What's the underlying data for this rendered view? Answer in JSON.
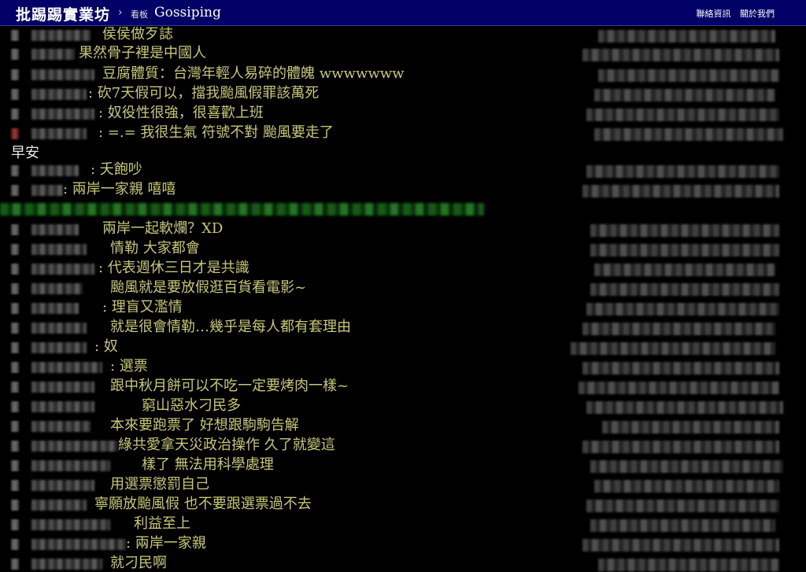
{
  "header": {
    "site_title": "批踢踢實業坊",
    "separator": "›",
    "board_label": "看板",
    "board_name": "Gossiping",
    "links": [
      "聯絡資訊",
      "關於我們"
    ]
  },
  "plain_text": "早安",
  "pushes": [
    {
      "text": "侯侯做歹誌",
      "tag": "gray"
    },
    {
      "text": "果然骨子裡是中國人",
      "tag": "gray"
    },
    {
      "text": "豆腐體質：台灣年輕人易碎的體魄 wwwwwww",
      "tag": "gray"
    },
    {
      "text": ": 砍7天假可以，擋我颱風假罪該萬死",
      "tag": "gray"
    },
    {
      "text": ": 奴役性很強，很喜歡上班",
      "tag": "gray"
    },
    {
      "text": ": =.= 我很生氣 符號不對 颱風要走了",
      "tag": "red"
    },
    {
      "text": ": 夭飽吵",
      "tag": "gray"
    },
    {
      "text": ": 兩岸一家親 嘻嘻",
      "tag": "gray"
    },
    {
      "text": "兩岸一起軟爛？XD",
      "tag": "gray"
    },
    {
      "text": "情勒 大家都會",
      "tag": "gray"
    },
    {
      "text": ": 代表週休三日才是共識",
      "tag": "gray"
    },
    {
      "text": "颱風就是要放假逛百貨看電影~",
      "tag": "gray"
    },
    {
      "text": ": 理盲又濫情",
      "tag": "gray"
    },
    {
      "text": "就是很會情勒…幾乎是每人都有套理由",
      "tag": "gray"
    },
    {
      "text": ": 奴",
      "tag": "gray"
    },
    {
      "text": ": 選票",
      "tag": "gray"
    },
    {
      "text": "跟中秋月餅可以不吃一定要烤肉一樣~",
      "tag": "gray"
    },
    {
      "text": "窮山惡水刁民多",
      "tag": "gray"
    },
    {
      "text": "本來要跑票了 好想跟駒駒告解",
      "tag": "gray"
    },
    {
      "text": "綠共愛拿天災政治操作 久了就變這",
      "tag": "gray"
    },
    {
      "text": "樣了 無法用科學處理",
      "tag": "gray"
    },
    {
      "text": "用選票懲罰自己",
      "tag": "gray"
    },
    {
      "text": "寧願放颱風假 也不要跟選票過不去",
      "tag": "gray"
    },
    {
      "text": "利益至上",
      "tag": "gray"
    },
    {
      "text": ": 兩岸一家親",
      "tag": "gray"
    },
    {
      "text": "就刁民啊",
      "tag": "gray"
    }
  ]
}
